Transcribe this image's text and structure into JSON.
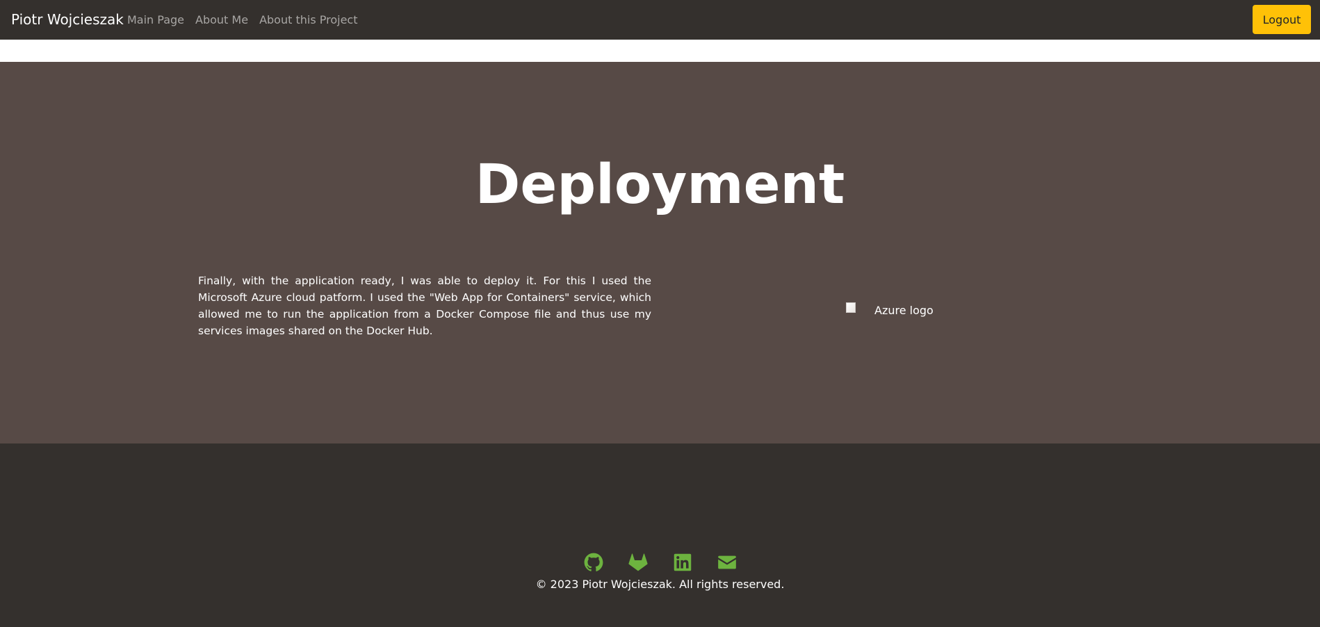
{
  "navbar": {
    "brand": "Piotr Wojcieszak",
    "links": [
      {
        "label": "Main Page"
      },
      {
        "label": "About Me"
      },
      {
        "label": "About this Project"
      }
    ],
    "logout_label": "Logout"
  },
  "main": {
    "title": "Deployment",
    "description": "Finally, with the application ready, I was able to deploy it. For this I used the Microsoft Azure cloud patform. I used the \"Web App for Containers\" service, which allowed me to run the application from a Docker Compose file and thus use my services images shared on the Docker Hub.",
    "image_alt": "Azure logo"
  },
  "footer": {
    "social": [
      {
        "icon": "github-icon"
      },
      {
        "icon": "gitlab-icon"
      },
      {
        "icon": "linkedin-icon"
      },
      {
        "icon": "email-icon"
      }
    ],
    "copyright": "© 2023 Piotr Wojcieszak. All rights reserved."
  },
  "colors": {
    "navbar_bg": "#34302d",
    "content_bg": "#574a46",
    "accent": "#ffc107",
    "icon_green": "#6db33f"
  }
}
